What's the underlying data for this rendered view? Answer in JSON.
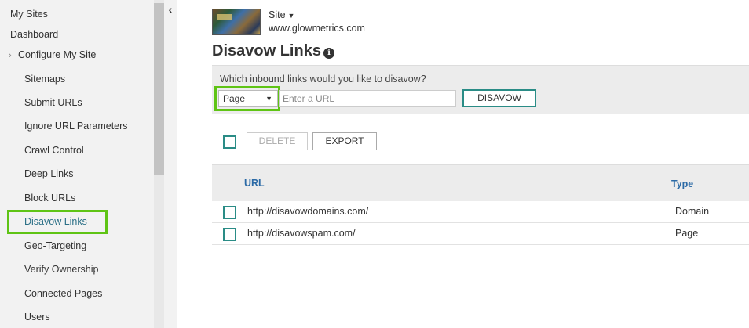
{
  "sidebar": {
    "top_items": [
      {
        "label": "My Sites"
      },
      {
        "label": "Dashboard"
      }
    ],
    "configure": {
      "label": "Configure My Site"
    },
    "sub_items": [
      {
        "label": "Sitemaps"
      },
      {
        "label": "Submit URLs"
      },
      {
        "label": "Ignore URL Parameters"
      },
      {
        "label": "Crawl Control"
      },
      {
        "label": "Deep Links"
      },
      {
        "label": "Block URLs"
      },
      {
        "label": "Disavow Links",
        "active": true
      },
      {
        "label": "Geo-Targeting"
      },
      {
        "label": "Verify Ownership"
      },
      {
        "label": "Connected Pages"
      },
      {
        "label": "Users"
      }
    ]
  },
  "site": {
    "label": "Site",
    "url": "www.glowmetrics.com"
  },
  "page": {
    "title": "Disavow Links"
  },
  "form": {
    "question": "Which inbound links would you like to disavow?",
    "type_selected": "Page",
    "url_placeholder": "Enter a URL",
    "disavow_label": "DISAVOW"
  },
  "toolbar": {
    "delete_label": "DELETE",
    "export_label": "EXPORT"
  },
  "table": {
    "columns": [
      "URL",
      "Type"
    ],
    "rows": [
      {
        "url": "http://disavowdomains.com/",
        "type": "Domain"
      },
      {
        "url": "http://disavowspam.com/",
        "type": "Page"
      }
    ]
  },
  "colors": {
    "highlight": "#5fc415",
    "accent_teal": "#2a8c86",
    "header_link": "#2b6aa6"
  }
}
